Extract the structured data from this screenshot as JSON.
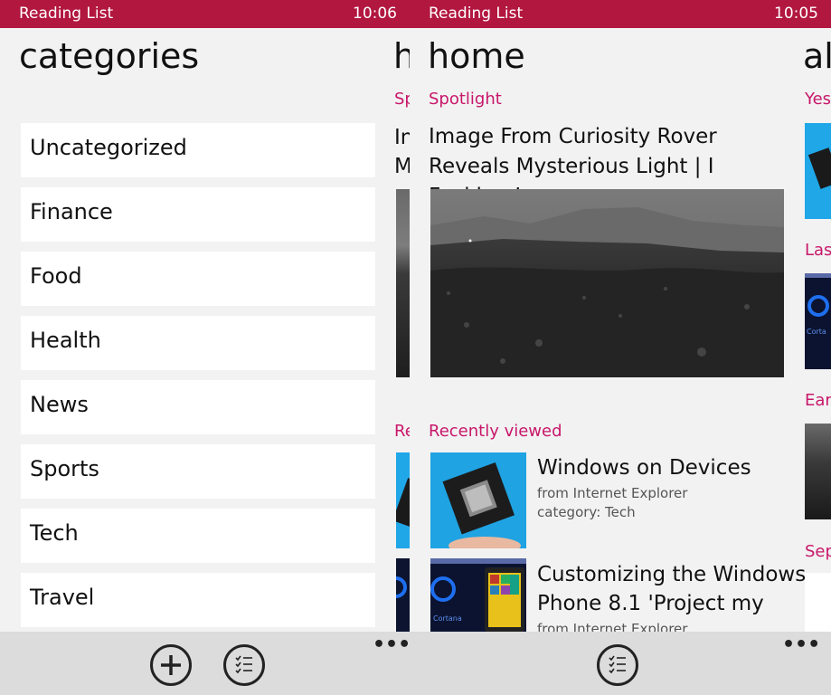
{
  "left": {
    "status": {
      "app_name": "Reading List",
      "time": "10:06"
    },
    "title": "categories",
    "peek_title": "h",
    "peek_section_1": "Sp",
    "peek_section_2": "Re",
    "peek_text_1": "In",
    "peek_text_2": "M",
    "categories": [
      "Uncategorized",
      "Finance",
      "Food",
      "Health",
      "News",
      "Sports",
      "Tech",
      "Travel"
    ],
    "appbar": {
      "add_icon": "plus-icon",
      "select_icon": "checklist-icon",
      "more": "•••"
    }
  },
  "right": {
    "status": {
      "app_name": "Reading List",
      "time": "10:05"
    },
    "title": "home",
    "peek_title": "al",
    "spotlight": {
      "label": "Spotlight",
      "title": "Image From Curiosity Rover Reveals Mysterious Light | I Fucking Love"
    },
    "recently_viewed": {
      "label": "Recently viewed",
      "items": [
        {
          "title": "Windows on Devices",
          "source": "from Internet Explorer",
          "category": "category: Tech",
          "thumb_text": ""
        },
        {
          "title": "Customizing the Windows Phone 8.1 'Project my",
          "source": "from Internet Explorer",
          "thumb_text": "Cortana"
        }
      ]
    },
    "peek_sections": [
      "Yes",
      "Las",
      "Ear",
      "Sep"
    ],
    "peek_thumb_text": "Corta",
    "appbar": {
      "select_icon": "checklist-icon",
      "more": "•••"
    }
  },
  "colors": {
    "accent": "#b2173f",
    "section": "#c8176a",
    "background": "#f2f2f2"
  }
}
